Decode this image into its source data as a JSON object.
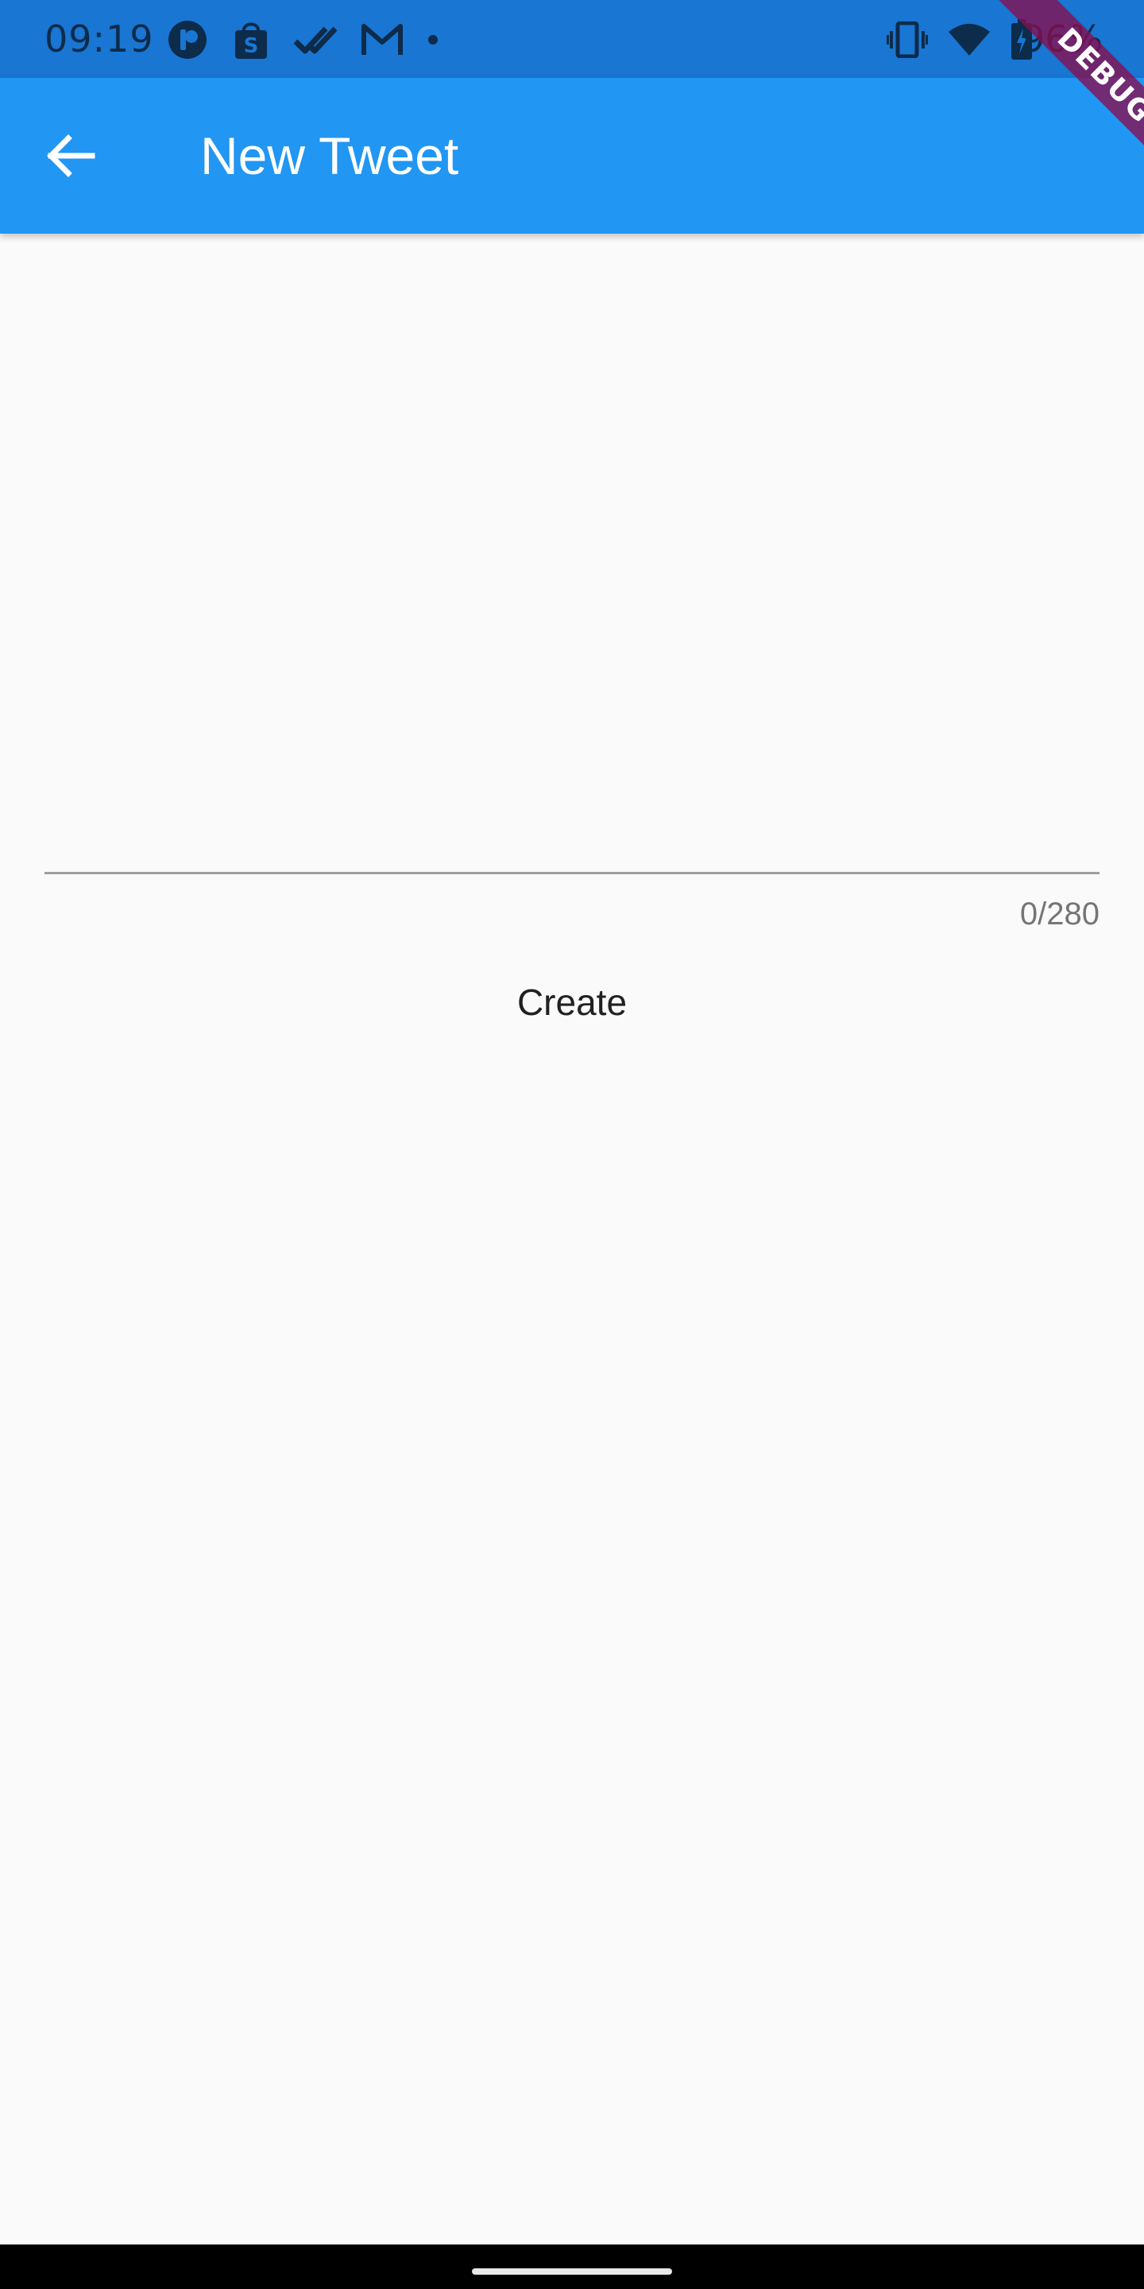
{
  "status_bar": {
    "time": "09:19",
    "battery_text": "96%",
    "left_icons": [
      "circle-r-icon",
      "shopping-bag-icon",
      "double-check-icon",
      "gmail-icon",
      "notification-dot-icon"
    ],
    "right_icons": [
      "vibrate-icon",
      "wifi-icon",
      "battery-charging-icon"
    ]
  },
  "app_bar": {
    "title": "New Tweet",
    "back_icon": "arrow-back-icon",
    "background": "#2196f3"
  },
  "debug_banner": {
    "label": "DEBUG"
  },
  "tweet_input": {
    "value": "",
    "counter": "0/280"
  },
  "create_button": {
    "label": "Create"
  }
}
